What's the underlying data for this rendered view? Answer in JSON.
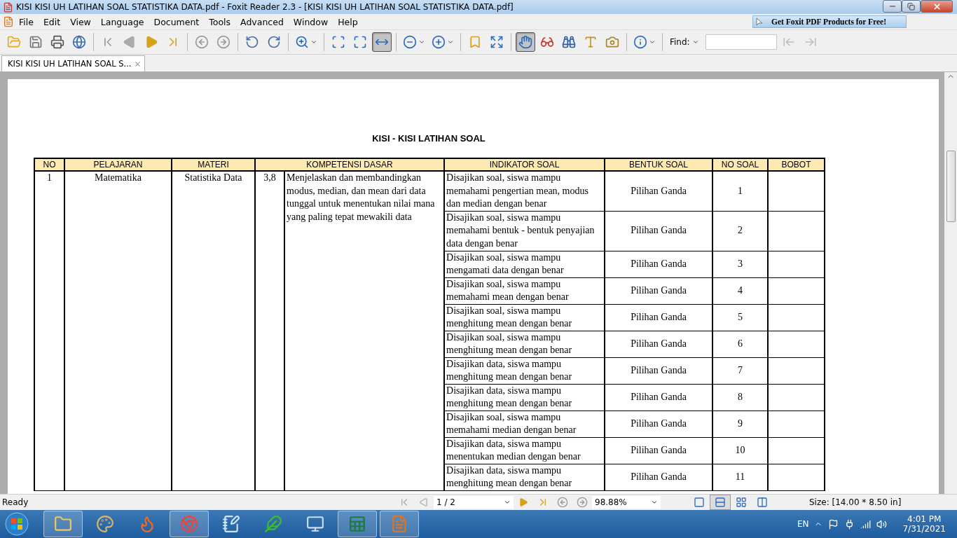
{
  "window": {
    "title": "KISI KISI UH LATIHAN SOAL STATISTIKA DATA.pdf - Foxit Reader 2.3 - [KISI KISI UH LATIHAN SOAL STATISTIKA DATA.pdf]"
  },
  "menu": [
    "File",
    "Edit",
    "View",
    "Language",
    "Document",
    "Tools",
    "Advanced",
    "Window",
    "Help"
  ],
  "promo": "Get Foxit PDF Products for Free!",
  "toolbar": [
    [
      {
        "kind": "open",
        "selected": false
      },
      {
        "kind": "save",
        "selected": false
      },
      {
        "kind": "print",
        "selected": false
      },
      {
        "kind": "email",
        "selected": false
      }
    ],
    [
      {
        "kind": "first",
        "selected": false
      },
      {
        "kind": "prev",
        "selected": false
      },
      {
        "kind": "next",
        "selected": false
      },
      {
        "kind": "last",
        "selected": false
      }
    ],
    [
      {
        "kind": "back",
        "selected": false
      },
      {
        "kind": "forward",
        "selected": false
      }
    ],
    [
      {
        "kind": "rotate-left",
        "selected": false
      },
      {
        "kind": "rotate-right",
        "selected": false
      }
    ],
    [
      {
        "kind": "zoom",
        "selected": false
      }
    ],
    [
      {
        "kind": "actual-size",
        "selected": false
      },
      {
        "kind": "fit-page",
        "selected": false
      },
      {
        "kind": "fit-width",
        "selected": true
      }
    ],
    [
      {
        "kind": "zoom-out",
        "selected": false
      },
      {
        "kind": "zoom-in",
        "selected": false
      }
    ],
    [
      {
        "kind": "bookmark",
        "selected": false
      },
      {
        "kind": "fullscreen",
        "selected": false
      }
    ],
    [
      {
        "kind": "hand",
        "selected": true
      },
      {
        "kind": "read",
        "selected": false
      },
      {
        "kind": "find",
        "selected": false
      },
      {
        "kind": "text",
        "selected": false
      },
      {
        "kind": "snapshot",
        "selected": false
      }
    ],
    [
      {
        "kind": "info",
        "selected": false
      }
    ]
  ],
  "find": {
    "label": "Find:"
  },
  "tabs": [
    {
      "label": "KISI KISI UH LATIHAN SOAL S...",
      "selected": true
    }
  ],
  "document": {
    "heading": "KISI - KISI LATIHAN SOAL",
    "columns": [
      "NO",
      "PELAJARAN",
      "MATERI",
      "KOMPETENSI DASAR",
      "INDIKATOR SOAL",
      "BENTUK SOAL",
      "NO SOAL",
      "BOBOT"
    ],
    "subject": {
      "no": "1",
      "pelajaran": "Matematika",
      "materi": "Statistika Data",
      "kd_no": "3,8",
      "kd_text": "Menjelaskan dan membandingkan modus, median, dan mean dari data tunggal untuk menentukan nilai mana yang paling tepat mewakili data"
    },
    "rows": [
      {
        "indikator": "Disajikan soal, siswa mampu memahami pengertian mean, modus dan median dengan benar",
        "bentuk": "Pilihan Ganda",
        "no_soal": "1"
      },
      {
        "indikator": "Disajikan soal, siswa mampu memahami bentuk - bentuk penyajian data dengan benar",
        "bentuk": "Pilihan Ganda",
        "no_soal": "2"
      },
      {
        "indikator": "Disajikan soal, siswa mampu mengamati data dengan benar",
        "bentuk": "Pilihan Ganda",
        "no_soal": "3"
      },
      {
        "indikator": "Disajikan soal, siswa mampu memahami mean dengan benar",
        "bentuk": "Pilihan Ganda",
        "no_soal": "4"
      },
      {
        "indikator": "Disajikan soal, siswa mampu menghitung mean dengan benar",
        "bentuk": "Pilihan Ganda",
        "no_soal": "5"
      },
      {
        "indikator": "Disajikan soal, siswa mampu menghitung mean dengan benar",
        "bentuk": "Pilihan Ganda",
        "no_soal": "6"
      },
      {
        "indikator": "Disajikan data, siswa mampu menghitung mean dengan benar",
        "bentuk": "Pilihan Ganda",
        "no_soal": "7"
      },
      {
        "indikator": "Disajikan data, siswa mampu menghitung mean dengan benar",
        "bentuk": "Pilihan Ganda",
        "no_soal": "8"
      },
      {
        "indikator": "Disajikan soal, siswa mampu memahami median dengan benar",
        "bentuk": "Pilihan Ganda",
        "no_soal": "9"
      },
      {
        "indikator": "Disajikan data, siswa mampu menentukan median dengan benar",
        "bentuk": "Pilihan Ganda",
        "no_soal": "10"
      },
      {
        "indikator": "Disajikan data, siswa mampu menghitung mean dengan benar",
        "bentuk": "Pilihan Ganda",
        "no_soal": "11"
      }
    ]
  },
  "status_bar": {
    "text": "Ready",
    "page": "1 / 2",
    "zoom": "98.88%",
    "views": [
      {
        "kind": "single",
        "selected": false
      },
      {
        "kind": "continuous",
        "selected": true
      },
      {
        "kind": "facing",
        "selected": false
      },
      {
        "kind": "continuous-facing",
        "selected": false
      }
    ],
    "size": "Size: [14.00 * 8.50 in]"
  },
  "taskbar": {
    "apps": [
      {
        "kind": "explorer",
        "running": true
      },
      {
        "kind": "paint",
        "running": false
      },
      {
        "kind": "firefox",
        "running": false
      },
      {
        "kind": "chrome",
        "running": true
      },
      {
        "kind": "notepad",
        "running": false
      },
      {
        "kind": "green",
        "running": false
      },
      {
        "kind": "keyboard",
        "running": false
      },
      {
        "kind": "excel",
        "running": true
      },
      {
        "kind": "foxit",
        "running": true
      }
    ],
    "language": "EN",
    "time": "4:01 PM",
    "date": "7/31/2021"
  }
}
